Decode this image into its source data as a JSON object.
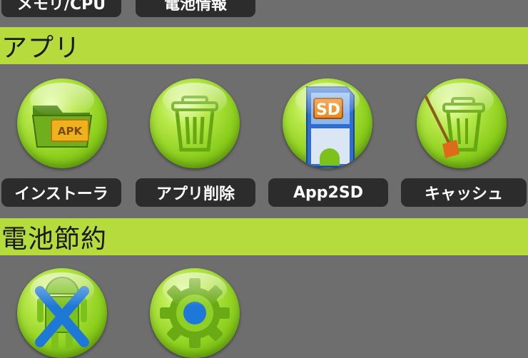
{
  "top_buttons": [
    {
      "label": "メモリ/CPU"
    },
    {
      "label": "電池情報"
    }
  ],
  "sections": [
    {
      "title": "アプリ",
      "items": [
        {
          "label": "インストーラ",
          "icon": "apk-folder-icon",
          "icon_text": "APK"
        },
        {
          "label": "アプリ削除",
          "icon": "trash-can-icon"
        },
        {
          "label": "App2SD",
          "icon": "sd-card-icon",
          "icon_text": "SD"
        },
        {
          "label": "キャッシュ",
          "icon": "broom-trash-icon"
        }
      ]
    },
    {
      "title": "電池節約",
      "items": [
        {
          "icon": "android-kill-icon"
        },
        {
          "icon": "gear-icon"
        }
      ]
    }
  ],
  "colors": {
    "background": "#6e6e6e",
    "section_header": "#b5dc3c",
    "label_button": "#2c2c2c",
    "icon_green": "#8ccf1d",
    "accent_blue": "#1e78d8",
    "accent_orange": "#f08a1c"
  }
}
